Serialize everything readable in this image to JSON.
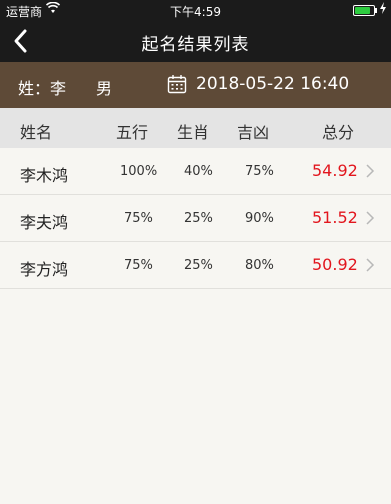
{
  "status_bar": {
    "carrier": "运营商",
    "time": "下午4:59",
    "battery_level": 0.95
  },
  "nav": {
    "title": "起名结果列表"
  },
  "info": {
    "surname_label": "姓：李",
    "gender": "男",
    "datetime": "2018-05-22 16:40"
  },
  "table": {
    "headers": [
      "姓名",
      "五行",
      "生肖",
      "吉凶",
      "总分"
    ],
    "rows": [
      {
        "name": "李木鸿",
        "wuxing": "100%",
        "shengxiao": "40%",
        "jixiong": "75%",
        "score": "54.92"
      },
      {
        "name": "李夫鸿",
        "wuxing": "75%",
        "shengxiao": "25%",
        "jixiong": "90%",
        "score": "51.52"
      },
      {
        "name": "李方鸿",
        "wuxing": "75%",
        "shengxiao": "25%",
        "jixiong": "80%",
        "score": "50.92"
      }
    ]
  },
  "colors": {
    "nav_bg": "#1b1b1b",
    "info_bg": "#5e4a37",
    "header_bg": "#e4e4e4",
    "score_red": "#e2161e",
    "page_bg": "#f7f6f2"
  }
}
